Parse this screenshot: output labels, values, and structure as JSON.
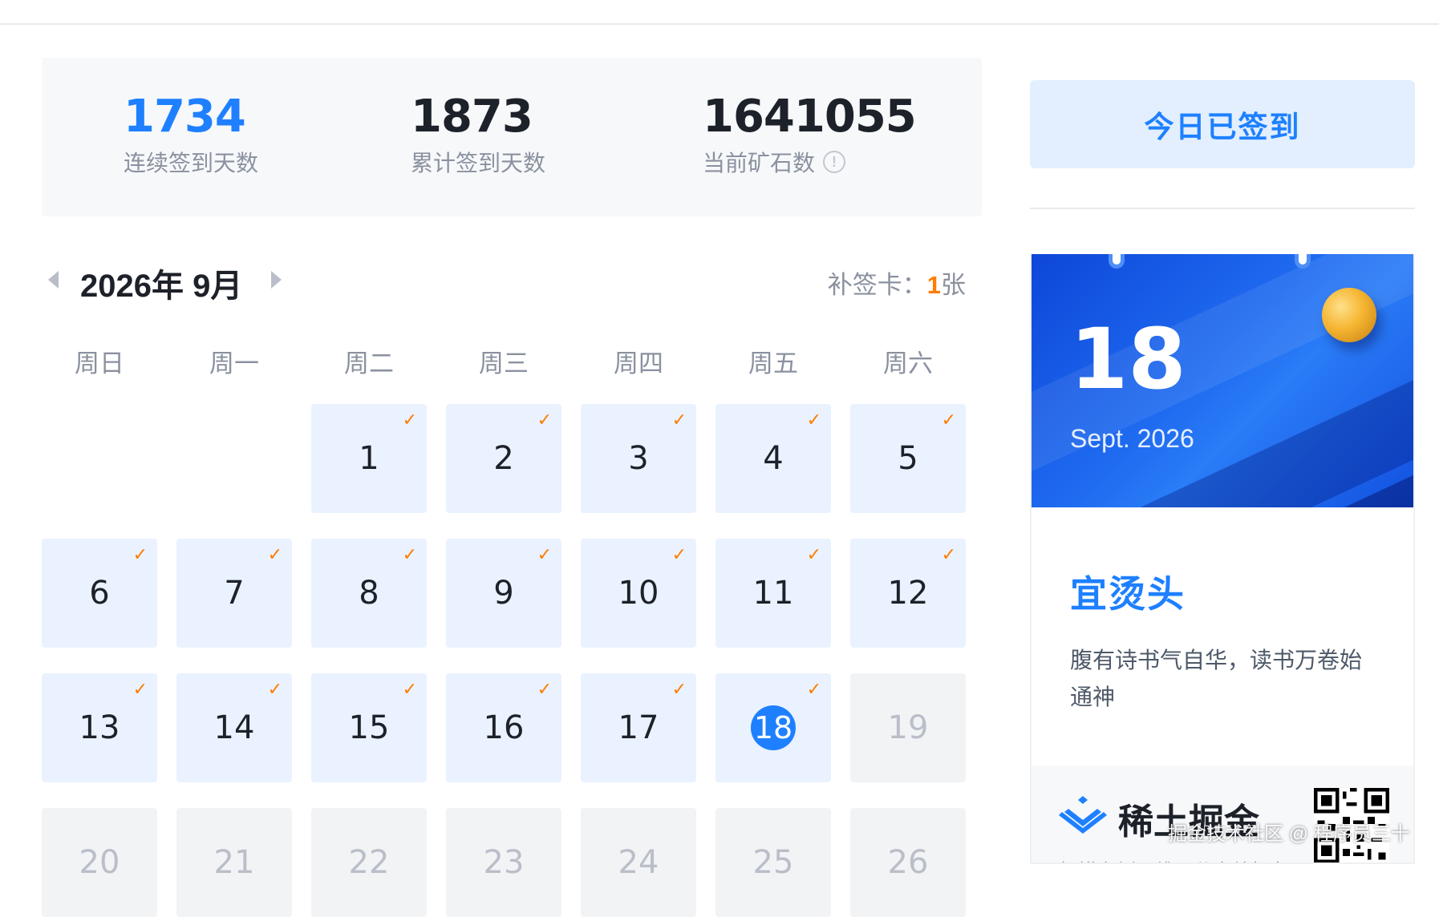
{
  "stats": {
    "consecutive": {
      "value": "1734",
      "label": "连续签到天数"
    },
    "total": {
      "value": "1873",
      "label": "累计签到天数"
    },
    "ore": {
      "value": "1641055",
      "label": "当前矿石数"
    }
  },
  "calendar": {
    "month_title": "2026年 9月",
    "makeup_label": "补签卡：",
    "makeup_count": "1",
    "makeup_unit": "张",
    "weekdays": [
      "周日",
      "周一",
      "周二",
      "周三",
      "周四",
      "周五",
      "周六"
    ],
    "check_mark": "✓",
    "days": [
      {
        "d": "1",
        "state": "signed"
      },
      {
        "d": "2",
        "state": "signed"
      },
      {
        "d": "3",
        "state": "signed"
      },
      {
        "d": "4",
        "state": "signed"
      },
      {
        "d": "5",
        "state": "signed"
      },
      {
        "d": "6",
        "state": "signed"
      },
      {
        "d": "7",
        "state": "signed"
      },
      {
        "d": "8",
        "state": "signed"
      },
      {
        "d": "9",
        "state": "signed"
      },
      {
        "d": "10",
        "state": "signed"
      },
      {
        "d": "11",
        "state": "signed"
      },
      {
        "d": "12",
        "state": "signed"
      },
      {
        "d": "13",
        "state": "signed"
      },
      {
        "d": "14",
        "state": "signed"
      },
      {
        "d": "15",
        "state": "signed"
      },
      {
        "d": "16",
        "state": "signed"
      },
      {
        "d": "17",
        "state": "signed"
      },
      {
        "d": "18",
        "state": "today"
      },
      {
        "d": "19",
        "state": "future"
      },
      {
        "d": "20",
        "state": "future"
      },
      {
        "d": "21",
        "state": "future"
      },
      {
        "d": "22",
        "state": "future"
      },
      {
        "d": "23",
        "state": "future"
      },
      {
        "d": "24",
        "state": "future"
      },
      {
        "d": "25",
        "state": "future"
      },
      {
        "d": "26",
        "state": "future"
      }
    ],
    "first_weekday": 2
  },
  "sidebar": {
    "signed_button": "今日已签到",
    "card": {
      "day": "18",
      "date": "Sept. 2026",
      "luck_title": "宜烫头",
      "luck_desc": "腹有诗书气自华，读书万卷始通神",
      "brand": "稀土掘金",
      "scan_text": "扫描右侧二维码分享给好友"
    }
  },
  "watermark": "掘金技术社区 @ 程序员三十",
  "colors": {
    "accent": "#1e80ff",
    "check": "#ff7d00",
    "signed_bg": "#eaf2ff",
    "future_bg": "#f2f3f5"
  }
}
